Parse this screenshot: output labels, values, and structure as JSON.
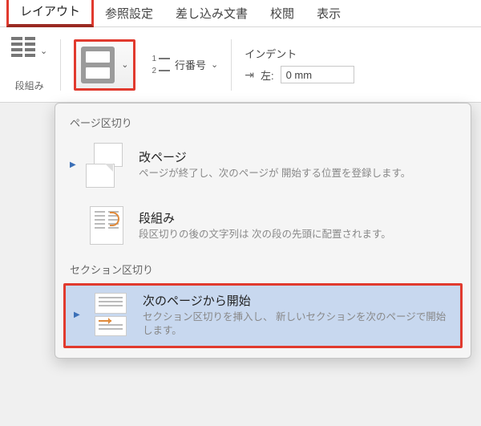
{
  "tabs": [
    {
      "label": "レイアウト",
      "active": true
    },
    {
      "label": "参照設定"
    },
    {
      "label": "差し込み文書"
    },
    {
      "label": "校閲"
    },
    {
      "label": "表示"
    }
  ],
  "ribbon": {
    "columns_group_label": "段組み",
    "line_numbers_label": "行番号",
    "indent": {
      "title": "インデント",
      "left_label": "左:",
      "left_value": "0 mm"
    }
  },
  "dropdown": {
    "section1_label": "ページ区切り",
    "section2_label": "セクション区切り",
    "items": {
      "page_break": {
        "title": "改ページ",
        "desc": "ページが終了し、次のページが\n開始する位置を登録します。"
      },
      "column_break": {
        "title": "段組み",
        "desc": "段区切りの後の文字列は\n次の段の先頭に配置されます。"
      },
      "next_page": {
        "title": "次のページから開始",
        "desc": "セクション区切りを挿入し、\n新しいセクションを次のページで開始します。"
      }
    }
  }
}
